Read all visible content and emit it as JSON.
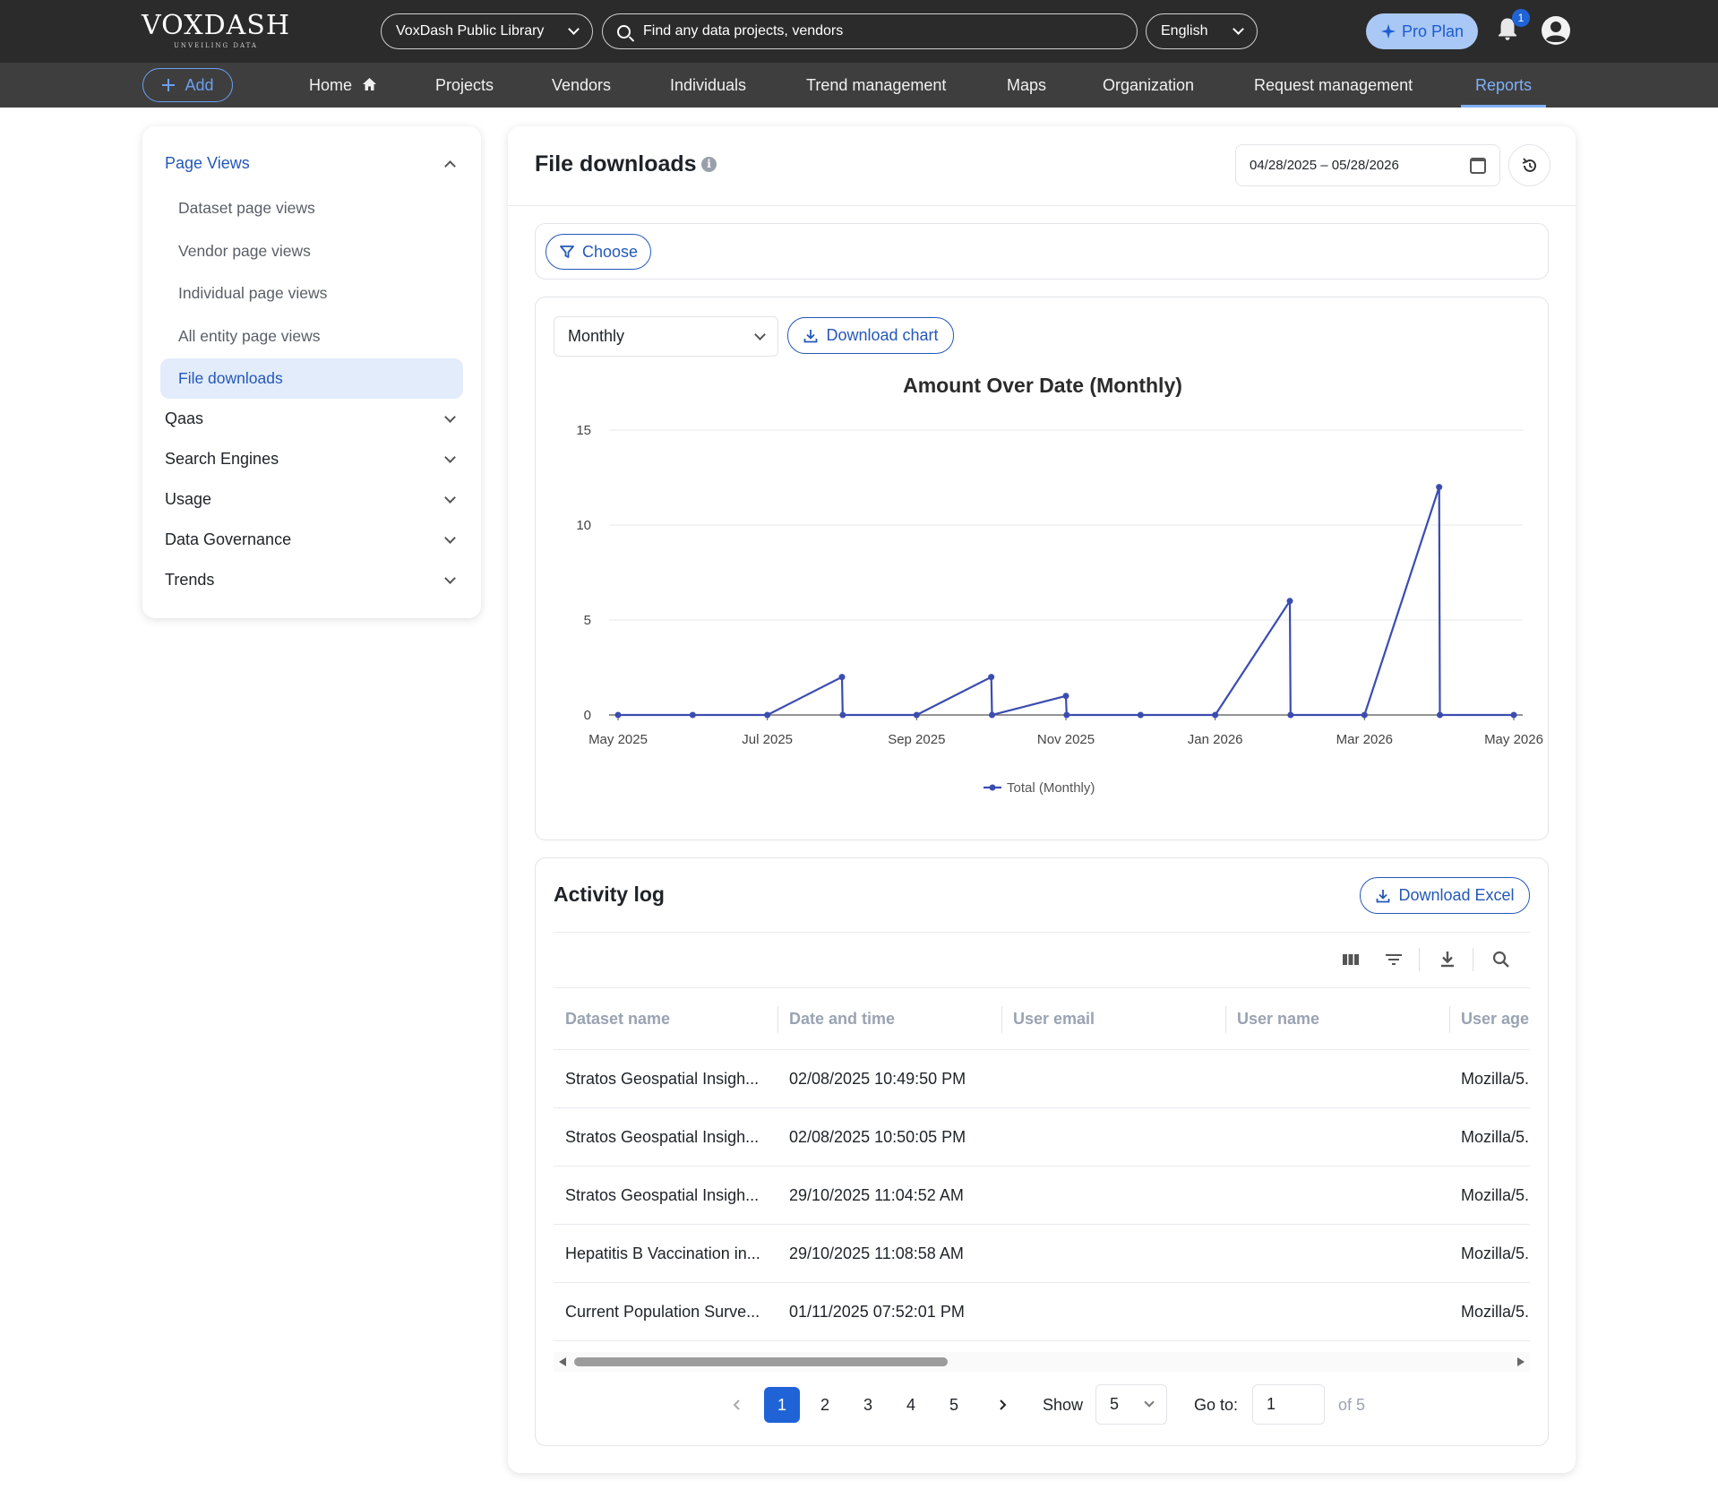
{
  "topbar": {
    "logo_name": "VOXDASH",
    "logo_tag": "UNVEILING DATA",
    "library": "VoxDash Public Library",
    "search_placeholder": "Find any data projects, vendors",
    "language": "English",
    "pro_label": "Pro Plan",
    "notification_count": "1"
  },
  "nav": {
    "add_label": "Add",
    "items": [
      "Home",
      "Projects",
      "Vendors",
      "Individuals",
      "Trend management",
      "Maps",
      "Organization",
      "Request management",
      "Reports"
    ],
    "active": "Reports"
  },
  "sidebar": {
    "page_views": {
      "label": "Page Views",
      "items": [
        "Dataset page views",
        "Vendor page views",
        "Individual page views",
        "All entity page views",
        "File downloads"
      ],
      "active": "File downloads"
    },
    "groups": [
      "Qaas",
      "Search Engines",
      "Usage",
      "Data Governance",
      "Trends"
    ]
  },
  "main": {
    "title": "File downloads",
    "info_glyph": "i",
    "date_range": "04/28/2025 – 05/28/2026",
    "choose_label": "Choose",
    "period": "Monthly",
    "download_chart_label": "Download chart"
  },
  "chart_data": {
    "type": "line",
    "title": "Amount Over Date (Monthly)",
    "x": [
      "2025-05",
      "2025-06",
      "2025-07",
      "2025-08",
      "2025-08",
      "2025-09",
      "2025-10",
      "2025-10",
      "2025-11",
      "2025-11",
      "2025-12",
      "2026-01",
      "2026-02",
      "2026-02",
      "2026-03",
      "2026-04",
      "2026-04",
      "2026-05"
    ],
    "series": [
      {
        "name": "Total (Monthly)",
        "values": [
          0,
          0,
          0,
          2,
          0,
          0,
          2,
          0,
          1,
          0,
          0,
          0,
          6,
          0,
          0,
          12,
          0,
          0
        ]
      }
    ],
    "x_tick_labels": [
      "May 2025",
      "Jul 2025",
      "Sep 2025",
      "Nov 2025",
      "Jan 2026",
      "Mar 2026",
      "May 2026"
    ],
    "y_ticks": [
      0,
      5,
      10,
      15
    ],
    "ylim": [
      0,
      15
    ],
    "grid": true,
    "legend_position": "bottom",
    "color": "#3b4cb0"
  },
  "activity": {
    "title": "Activity log",
    "download_excel_label": "Download Excel",
    "columns": [
      "Dataset name",
      "Date and time",
      "User email",
      "User name",
      "User agent"
    ],
    "rows": [
      [
        "Stratos Geospatial Insigh...",
        "02/08/2025 10:49:50 PM",
        "",
        "",
        "Mozilla/5."
      ],
      [
        "Stratos Geospatial Insigh...",
        "02/08/2025 10:50:05 PM",
        "",
        "",
        "Mozilla/5."
      ],
      [
        "Stratos Geospatial Insigh...",
        "29/10/2025 11:04:52 AM",
        "",
        "",
        "Mozilla/5."
      ],
      [
        "Hepatitis B Vaccination in...",
        "29/10/2025 11:08:58 AM",
        "",
        "",
        "Mozilla/5."
      ],
      [
        "Current Population Surve...",
        "01/11/2025 07:52:01 PM",
        "",
        "",
        "Mozilla/5."
      ]
    ]
  },
  "pagination": {
    "pages": [
      "1",
      "2",
      "3",
      "4",
      "5"
    ],
    "current": "1",
    "show_label": "Show",
    "show_value": "5",
    "goto_label": "Go to:",
    "goto_value": "1",
    "of_label": "of 5"
  }
}
